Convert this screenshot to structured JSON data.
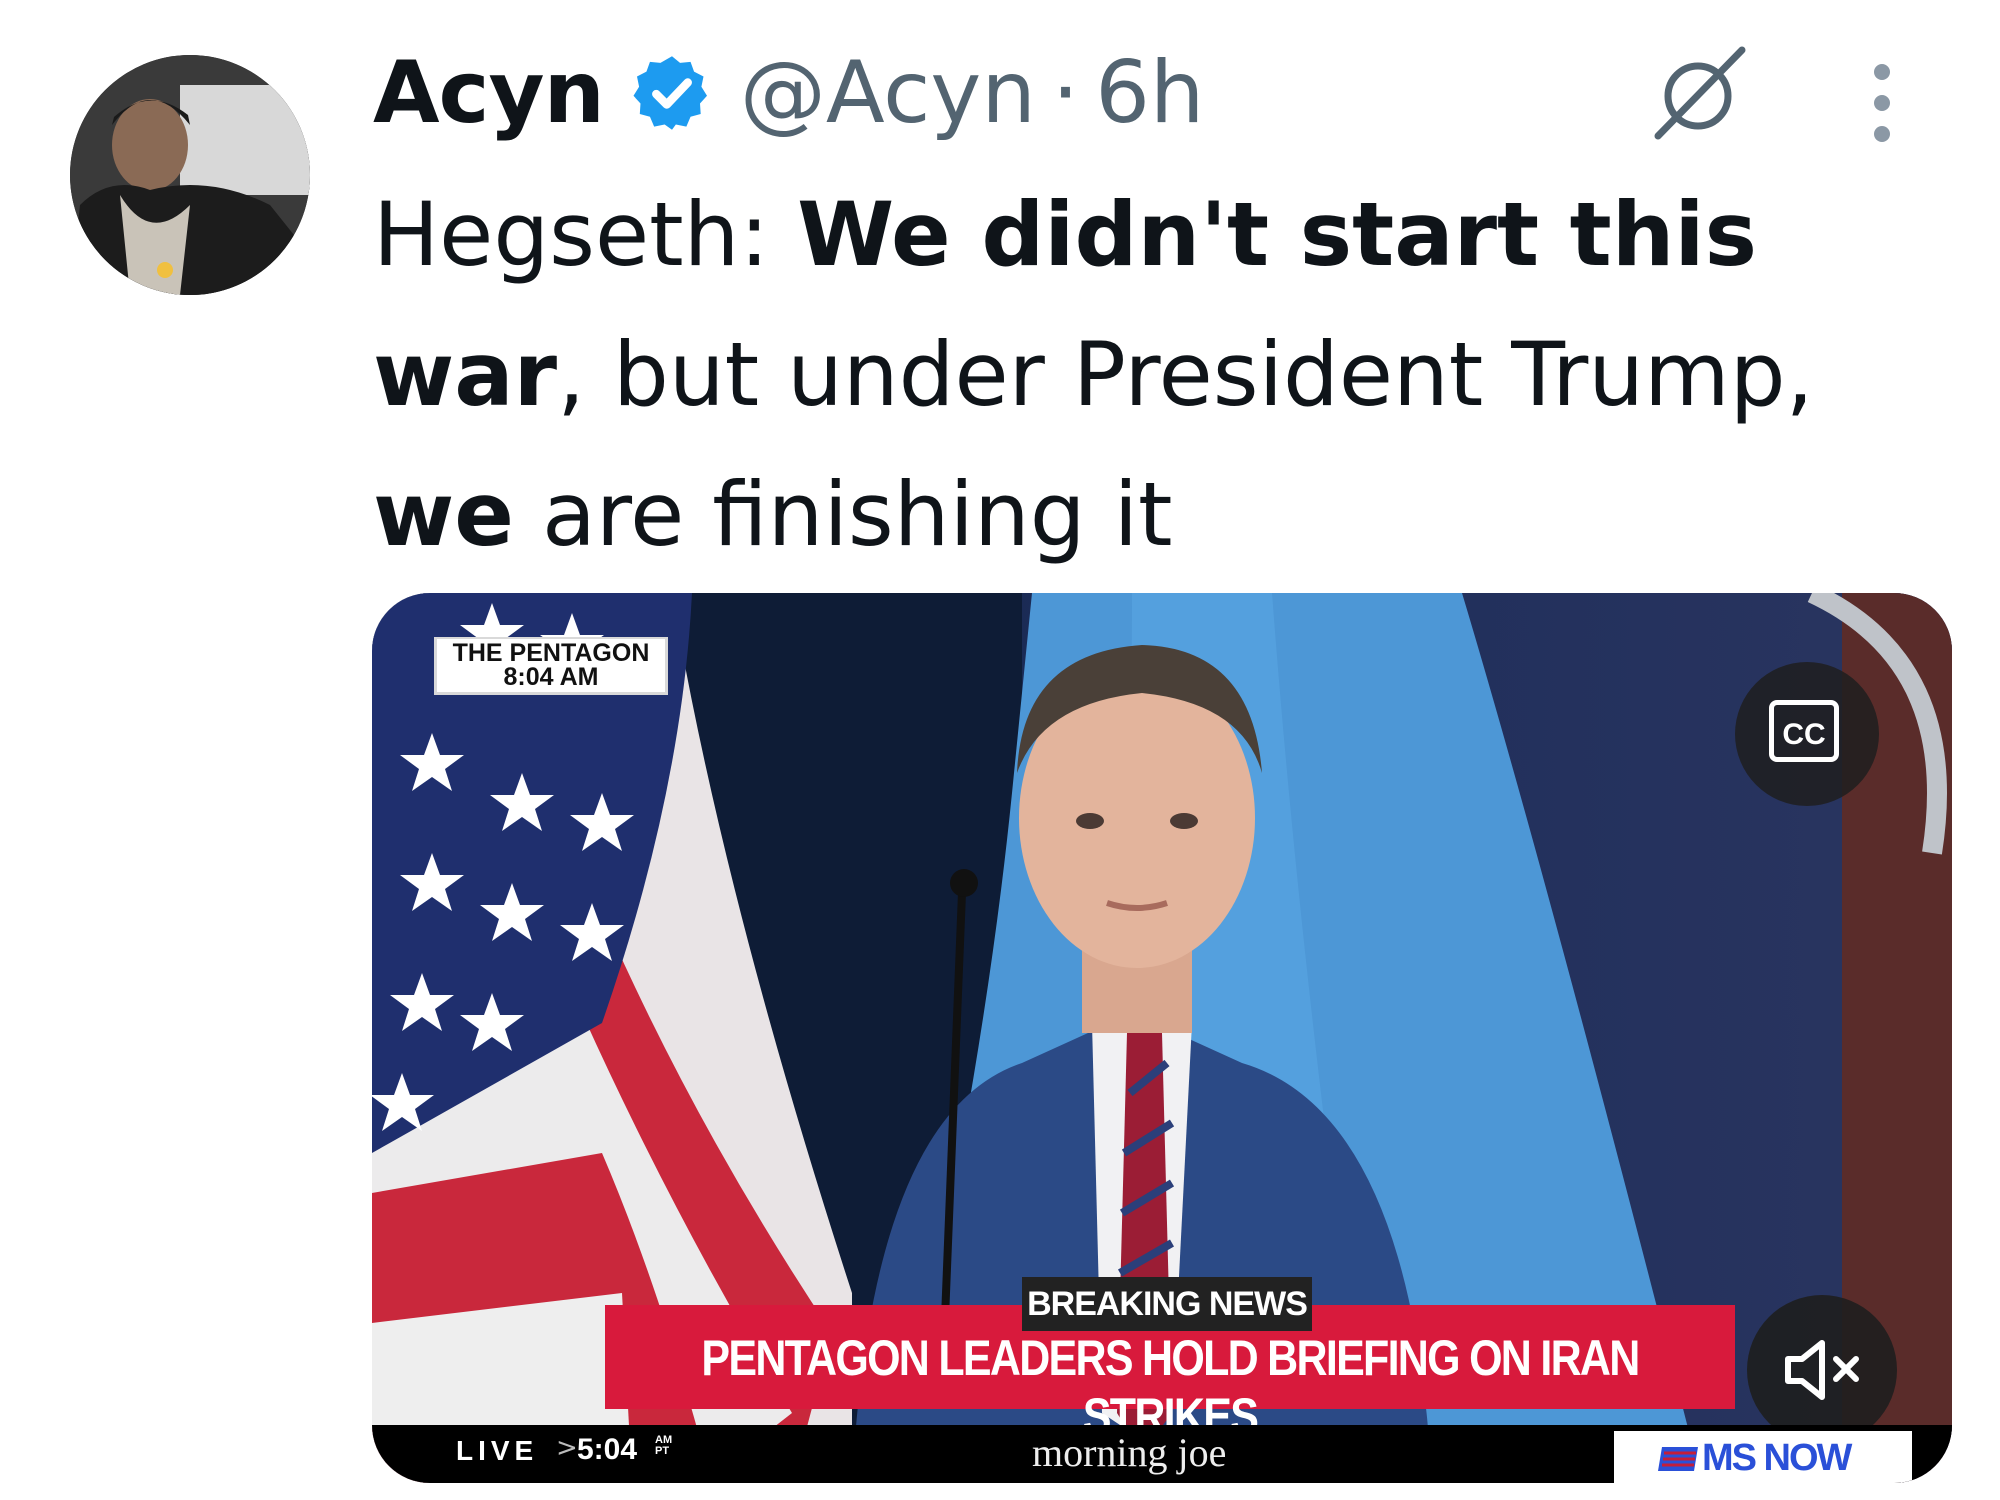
{
  "author": {
    "display_name": "Acyn",
    "handle": "@Acyn",
    "separator": "·",
    "time_ago": "6h"
  },
  "tweet": {
    "parts": [
      {
        "text": "Hegseth: ",
        "bold": false
      },
      {
        "text": "We didn't start this war",
        "bold": true
      },
      {
        "text": ", but under President Trump, ",
        "bold": false
      },
      {
        "text": "we",
        "bold": true
      },
      {
        "text": " are finishing it",
        "bold": false
      }
    ]
  },
  "video": {
    "location_label": "THE PENTAGON",
    "location_time": "8:04 AM",
    "cc_label": "CC",
    "breaking_label": "BREAKING NEWS",
    "headline": "PENTAGON LEADERS HOLD BRIEFING ON IRAN STRIKES",
    "live_label": "LIVE",
    "live_arrow": ">",
    "live_time": "5:04",
    "live_ampm_top": "AM",
    "live_ampm_bottom": "PT",
    "show_name": "morning joe",
    "network_name": "MS NOW"
  },
  "icons": {
    "verified": "verified-badge-icon",
    "grok": "grok-icon",
    "more": "more-options-icon",
    "cc": "closed-captions-icon",
    "mute": "muted-speaker-icon"
  },
  "colors": {
    "verified_blue": "#1d9bf0",
    "secondary_text": "#536471",
    "breaking_red": "#d81a3c",
    "network_blue": "#2a50d8"
  }
}
